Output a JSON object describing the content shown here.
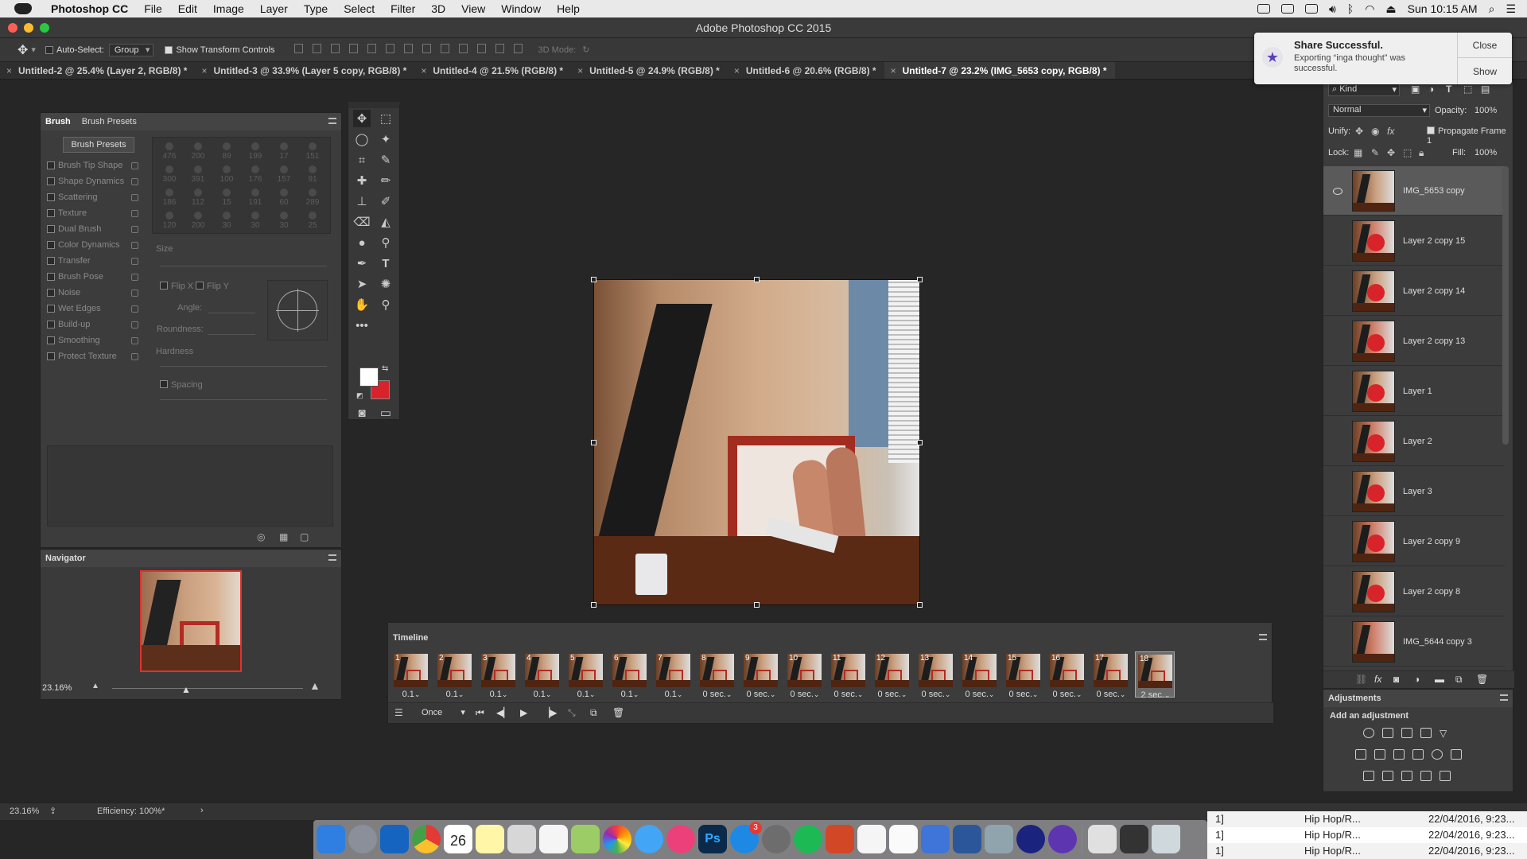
{
  "menubar": {
    "app": "Photoshop CC",
    "items": [
      "File",
      "Edit",
      "Image",
      "Layer",
      "Type",
      "Select",
      "Filter",
      "3D",
      "View",
      "Window",
      "Help"
    ],
    "clock": "Sun 10:15 AM"
  },
  "window": {
    "title": "Adobe Photoshop CC 2015"
  },
  "options": {
    "auto_select": "Auto-Select:",
    "auto_select_value": "Group",
    "show_transform": "Show Transform Controls",
    "mode3d": "3D Mode:"
  },
  "tabs": [
    "Untitled-2 @ 25.4% (Layer 2, RGB/8) *",
    "Untitled-3 @ 33.9% (Layer 5 copy, RGB/8) *",
    "Untitled-4 @ 21.5% (RGB/8) *",
    "Untitled-5 @ 24.9% (RGB/8) *",
    "Untitled-6 @ 20.6% (RGB/8) *",
    "Untitled-7 @ 23.2% (IMG_5653 copy, RGB/8) *"
  ],
  "brush": {
    "tab1": "Brush",
    "tab2": "Brush Presets",
    "presets_button": "Brush Presets",
    "options": [
      "Brush Tip Shape",
      "Shape Dynamics",
      "Scattering",
      "Texture",
      "Dual Brush",
      "Color Dynamics",
      "Transfer",
      "Brush Pose",
      "Noise",
      "Wet Edges",
      "Build-up",
      "Smoothing",
      "Protect Texture"
    ],
    "tip_sizes": [
      "476",
      "200",
      "89",
      "199",
      "17",
      "151",
      "300",
      "391",
      "100",
      "176",
      "157",
      "91",
      "186",
      "112",
      "15",
      "191",
      "60",
      "289",
      "120",
      "200",
      "30",
      "30",
      "30",
      "25"
    ],
    "size": "Size",
    "flip_x": "Flip X",
    "flip_y": "Flip Y",
    "angle": "Angle:",
    "roundness": "Roundness:",
    "hardness": "Hardness",
    "spacing": "Spacing"
  },
  "navigator": {
    "title": "Navigator",
    "zoom": "23.16%"
  },
  "timeline": {
    "title": "Timeline",
    "loop": "Once",
    "frames": [
      {
        "n": "1",
        "t": "0.1"
      },
      {
        "n": "2",
        "t": "0.1"
      },
      {
        "n": "3",
        "t": "0.1"
      },
      {
        "n": "4",
        "t": "0.1"
      },
      {
        "n": "5",
        "t": "0.1"
      },
      {
        "n": "6",
        "t": "0.1"
      },
      {
        "n": "7",
        "t": "0.1"
      },
      {
        "n": "8",
        "t": "0 sec."
      },
      {
        "n": "9",
        "t": "0 sec."
      },
      {
        "n": "10",
        "t": "0 sec."
      },
      {
        "n": "11",
        "t": "0 sec."
      },
      {
        "n": "12",
        "t": "0 sec."
      },
      {
        "n": "13",
        "t": "0 sec."
      },
      {
        "n": "14",
        "t": "0 sec."
      },
      {
        "n": "15",
        "t": "0 sec."
      },
      {
        "n": "16",
        "t": "0 sec."
      },
      {
        "n": "17",
        "t": "0 sec."
      },
      {
        "n": "18",
        "t": "2 sec."
      }
    ]
  },
  "layers": {
    "kind": "Kind",
    "blend": "Normal",
    "opacity_label": "Opacity:",
    "opacity": "100%",
    "unify": "Unify:",
    "propagate": "Propagate Frame 1",
    "lock": "Lock:",
    "fill_label": "Fill:",
    "fill": "100%",
    "items": [
      "IMG_5653 copy",
      "Layer 2 copy 15",
      "Layer 2 copy 14",
      "Layer 2 copy 13",
      "Layer 1",
      "Layer 2",
      "Layer 3",
      "Layer 2 copy 9",
      "Layer 2 copy 8",
      "IMG_5644 copy 3"
    ]
  },
  "adjustments": {
    "title": "Adjustments",
    "hint": "Add an adjustment"
  },
  "notification": {
    "title": "Share Successful.",
    "body": "Exporting “inga thought” was successful.",
    "close": "Close",
    "show": "Show"
  },
  "status": {
    "zoom": "23.16%",
    "efficiency": "Efficiency: 100%*"
  },
  "background_rows": [
    {
      "num": "1]",
      "genre": "Hip Hop/R...",
      "date": "22/04/2016, 9:23..."
    },
    {
      "num": "1]",
      "genre": "Hip Hop/R...",
      "date": "22/04/2016, 9:23..."
    },
    {
      "num": "1]",
      "genre": "Hip Hop/R...",
      "date": "22/04/2016, 9:23..."
    }
  ],
  "dock": {
    "calendar_day": "26",
    "appstore_badge": "3",
    "ps_label": "Ps"
  }
}
